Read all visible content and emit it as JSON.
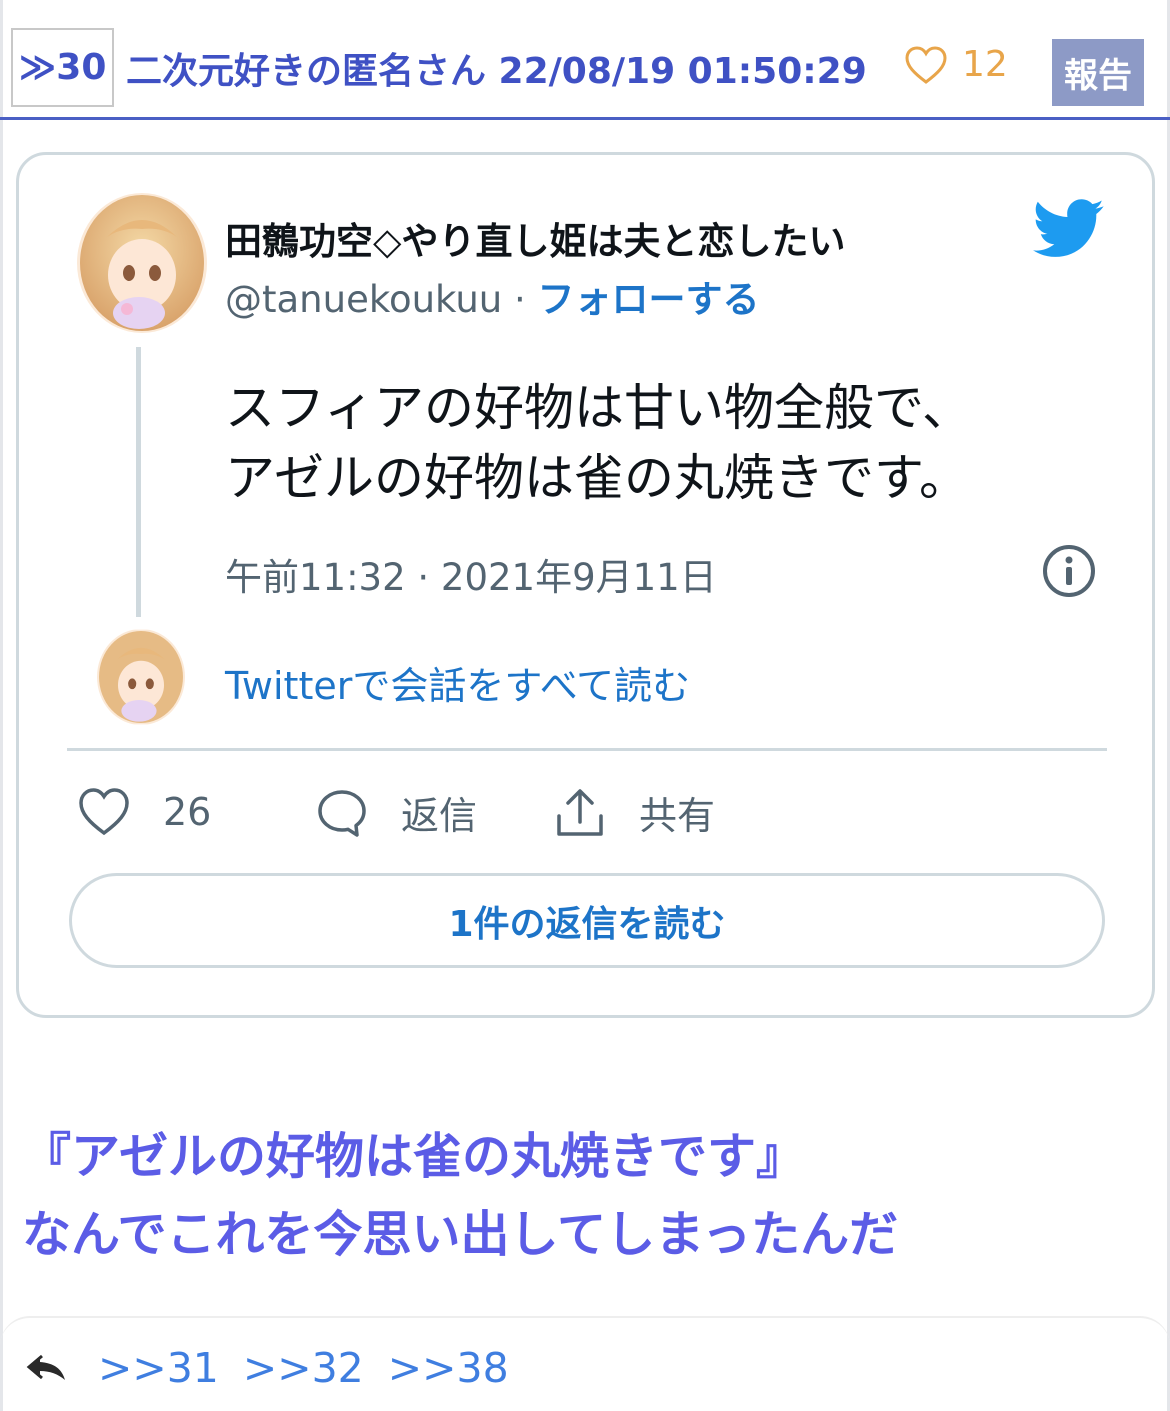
{
  "post": {
    "res_number": "≫30",
    "poster_info": "二次元好きの匿名さん 22/08/19 01:50:29",
    "like_count": "12",
    "report_label": "報告"
  },
  "tweet": {
    "author_name": "田鷯功空◇やり直し姫は夫と恋したい",
    "handle": "@tanuekoukuu",
    "separator": " · ",
    "follow_label": "フォローする",
    "text_line1": "スフィアの好物は甘い物全般で、",
    "text_line2": "アゼルの好物は雀の丸焼きです。",
    "timestamp": "午前11:32 · 2021年9月11日",
    "read_conversation": "Twitterで会話をすべて読む",
    "likes": "26",
    "reply_label": "返信",
    "share_label": "共有",
    "read_replies_button": "1件の返信を読む",
    "brand_color": "#1d9bf0"
  },
  "comment": {
    "line1": "『アゼルの好物は雀の丸焼きです』",
    "line2": "なんでこれを今思い出してしまったんだ"
  },
  "replies": {
    "links": [
      ">>31",
      ">>32",
      ">>38"
    ]
  },
  "icons": [
    "heart-icon",
    "twitter-bird-icon",
    "info-icon",
    "comment-icon",
    "share-icon",
    "reply-arrow-icon"
  ]
}
